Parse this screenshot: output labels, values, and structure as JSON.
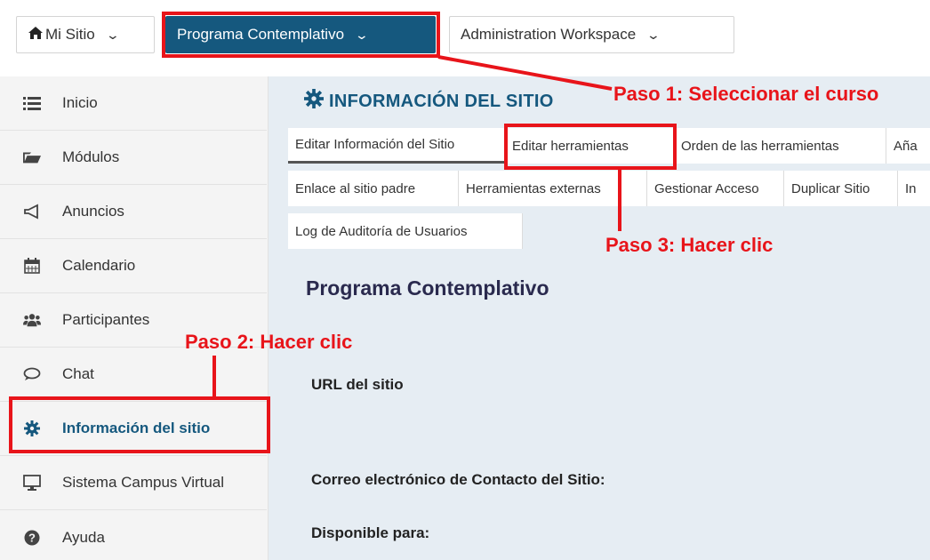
{
  "topbar": {
    "sites": [
      {
        "label": "Mi Sitio",
        "icon": "home-icon"
      },
      {
        "label": "Programa Contemplativo"
      },
      {
        "label": "Administration Workspace"
      }
    ],
    "chevron": "⌄"
  },
  "sidebar": {
    "items": [
      {
        "label": "Inicio",
        "icon": "list-icon"
      },
      {
        "label": "Módulos",
        "icon": "folder-icon"
      },
      {
        "label": "Anuncios",
        "icon": "megaphone-icon"
      },
      {
        "label": "Calendario",
        "icon": "calendar-icon"
      },
      {
        "label": "Participantes",
        "icon": "users-icon"
      },
      {
        "label": "Chat",
        "icon": "chat-icon"
      },
      {
        "label": "Información del sitio",
        "icon": "gear-icon"
      },
      {
        "label": "Sistema Campus Virtual",
        "icon": "monitor-icon"
      },
      {
        "label": "Ayuda",
        "icon": "help-icon"
      }
    ]
  },
  "main": {
    "section_title": "INFORMACIÓN DEL SITIO",
    "tabs_row1": [
      "Editar Información del Sitio",
      "Editar herramientas",
      "Orden de las herramientas",
      "Aña"
    ],
    "tabs_row2": [
      "Enlace al sitio padre",
      "Herramientas externas",
      "Gestionar Acceso",
      "Duplicar Sitio",
      "In"
    ],
    "tabs_row3": [
      "Log de Auditoría de Usuarios"
    ],
    "site_name": "Programa Contemplativo",
    "fields": {
      "url": "URL del sitio",
      "email": "Correo electrónico de Contacto del Sitio:",
      "available": "Disponible para:"
    }
  },
  "annotations": {
    "step1": "Paso 1: Seleccionar el curso",
    "step2": "Paso 2: Hacer clic",
    "step3": "Paso 3: Hacer clic"
  },
  "colors": {
    "accent": "#15587e",
    "annotation": "#e8141a",
    "main_bg": "#e6edf3",
    "sidebar_bg": "#f4f4f4"
  }
}
